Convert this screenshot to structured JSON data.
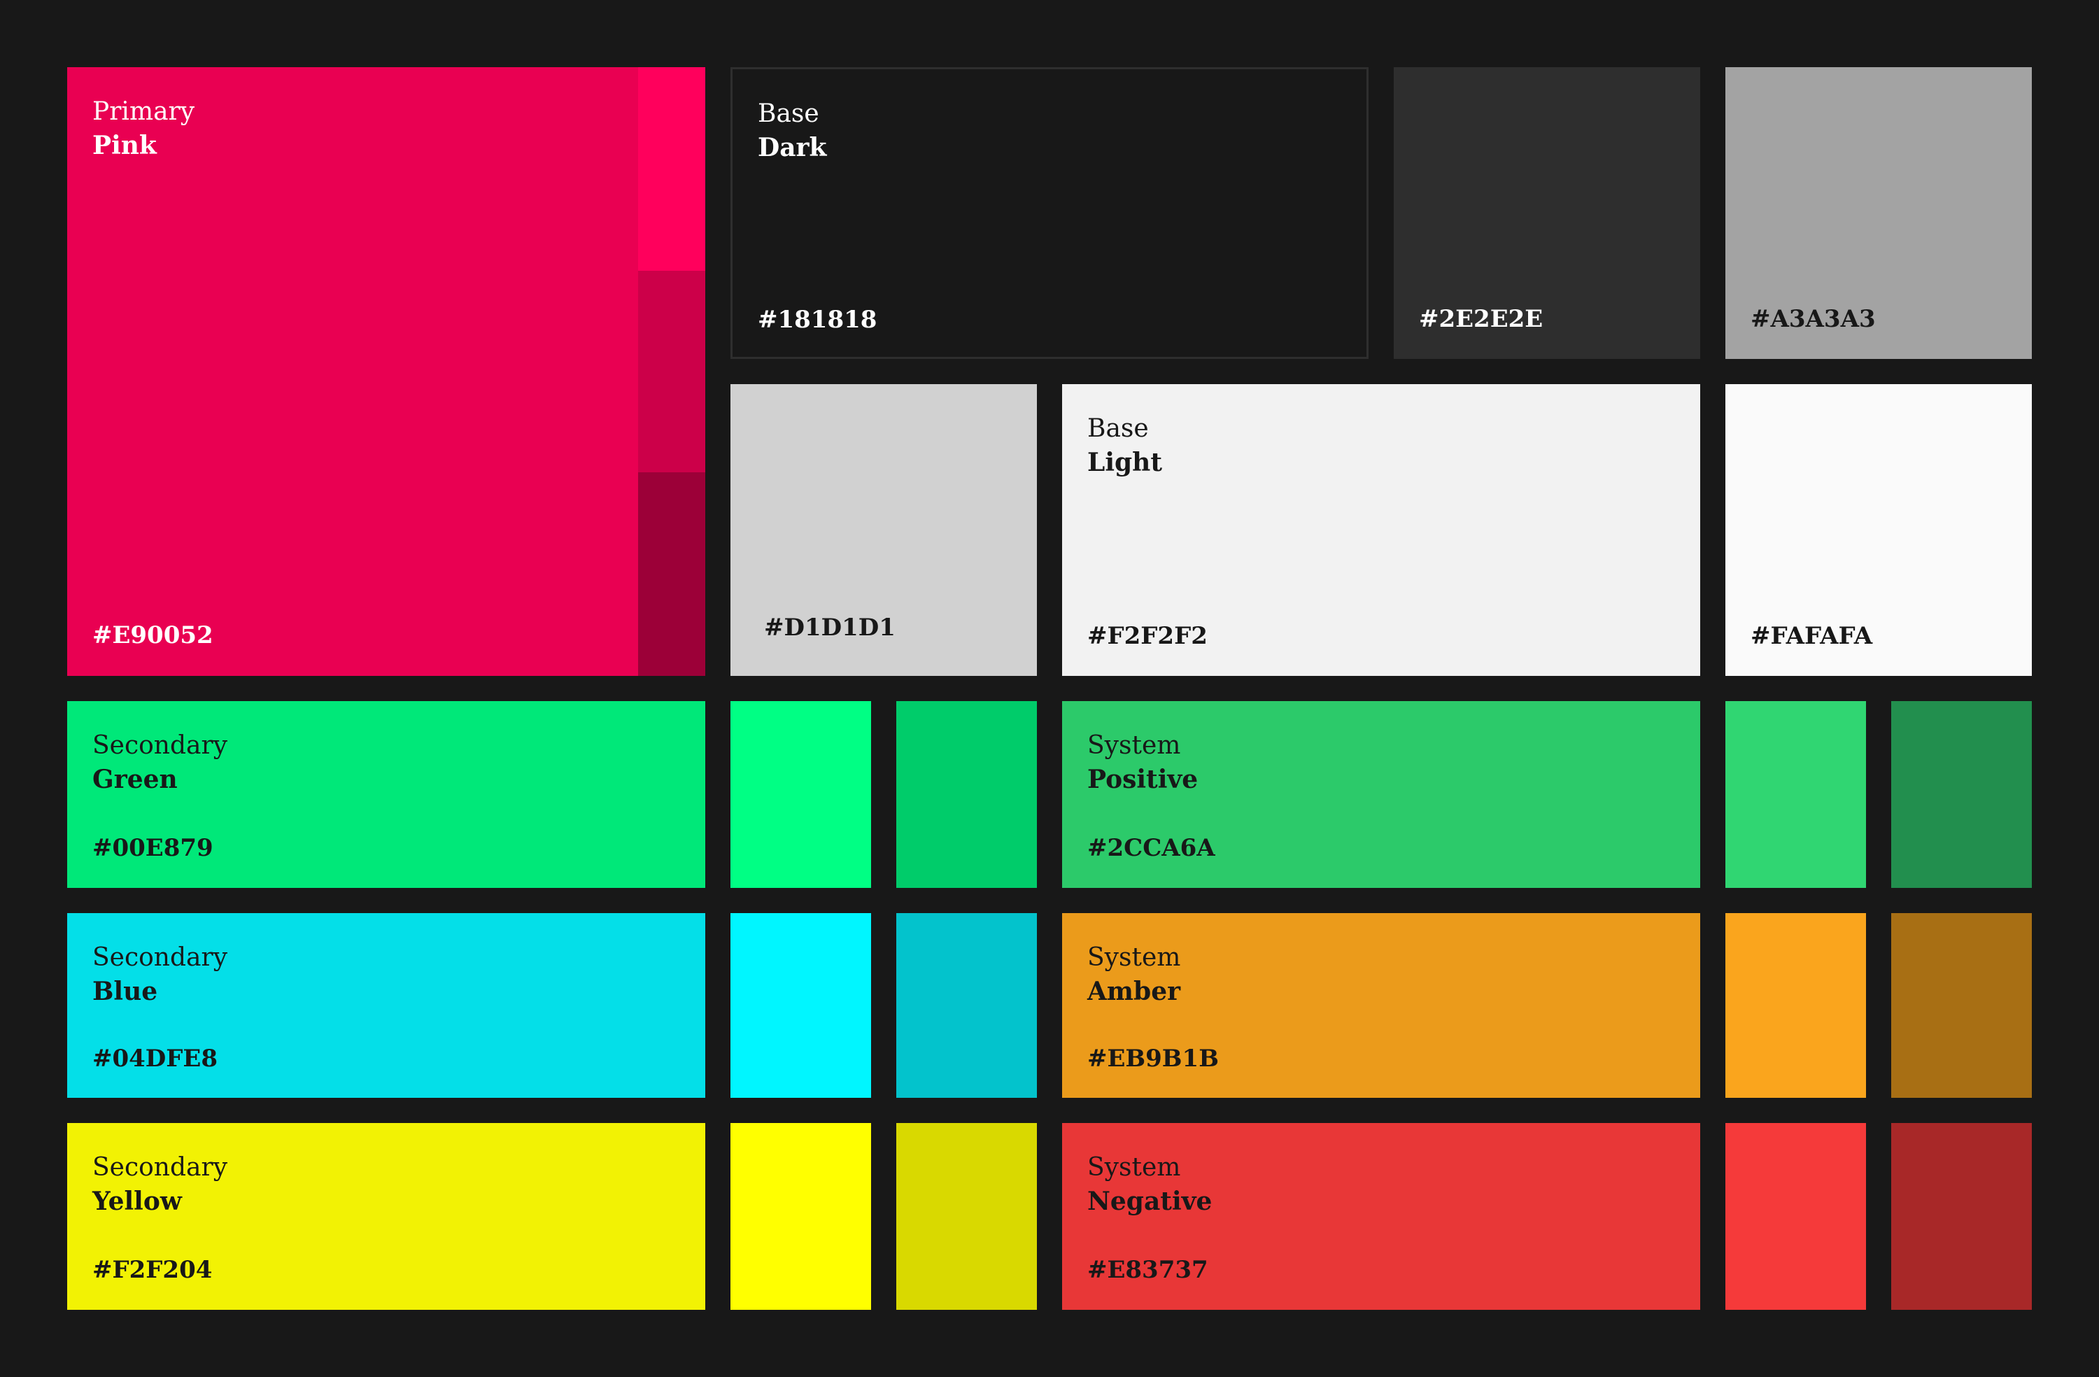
{
  "swatches": {
    "primary_pink": {
      "category": "Primary",
      "name": "Pink",
      "hex": "#E90052"
    },
    "primary_pink_light": {
      "hex": "#FF005C"
    },
    "primary_pink_mid": {
      "hex": "#CC0049"
    },
    "primary_pink_dark": {
      "hex": "#9C0038"
    },
    "base_dark": {
      "category": "Base",
      "name": "Dark",
      "hex": "#181818"
    },
    "gray_2e": {
      "hex": "#2E2E2E"
    },
    "gray_a3": {
      "hex": "#A3A3A3"
    },
    "gray_d1": {
      "hex": "#D1D1D1"
    },
    "base_light": {
      "category": "Base",
      "name": "Light",
      "hex": "#F2F2F2"
    },
    "white_fa": {
      "hex": "#FAFAFA"
    },
    "secondary_green": {
      "category": "Secondary",
      "name": "Green",
      "hex": "#00E879"
    },
    "green_light": {
      "hex": "#00FF84"
    },
    "green_dark": {
      "hex": "#00CC6A"
    },
    "system_positive": {
      "category": "System",
      "name": "Positive",
      "hex": "#2CCA6A"
    },
    "positive_light": {
      "hex": "#30D672"
    },
    "positive_dark": {
      "hex": "#228F4E"
    },
    "secondary_blue": {
      "category": "Secondary",
      "name": "Blue",
      "hex": "#04DFE8"
    },
    "blue_light": {
      "hex": "#00F6FF"
    },
    "blue_dark": {
      "hex": "#03C3CC"
    },
    "system_amber": {
      "category": "System",
      "name": "Amber",
      "hex": "#EB9B1B"
    },
    "amber_light": {
      "hex": "#FAA51D"
    },
    "amber_dark": {
      "hex": "#A86F14"
    },
    "secondary_yellow": {
      "category": "Secondary",
      "name": "Yellow",
      "hex": "#F2F204"
    },
    "yellow_light": {
      "hex": "#FFFF00"
    },
    "yellow_dark": {
      "hex": "#D9D900"
    },
    "system_negative": {
      "category": "System",
      "name": "Negative",
      "hex": "#E83737"
    },
    "negative_light": {
      "hex": "#F53A3A"
    },
    "negative_dark": {
      "hex": "#A82828"
    }
  }
}
